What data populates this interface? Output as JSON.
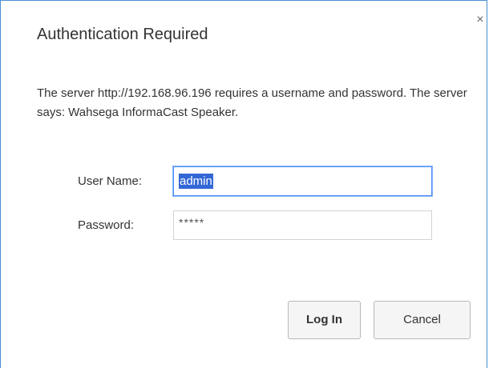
{
  "dialog": {
    "title": "Authentication Required",
    "close_glyph": "×",
    "message": "The server http://192.168.96.196 requires a username and password. The server says: Wahsega InformaCast Speaker."
  },
  "form": {
    "username_label": "User Name:",
    "username_value": "admin",
    "password_label": "Password:",
    "password_masked": "*****"
  },
  "buttons": {
    "login_label": "Log In",
    "cancel_label": "Cancel"
  },
  "colors": {
    "border_accent": "#4a8fd6",
    "focus_outline": "#4d90fe",
    "selection_highlight": "#3367d6"
  }
}
